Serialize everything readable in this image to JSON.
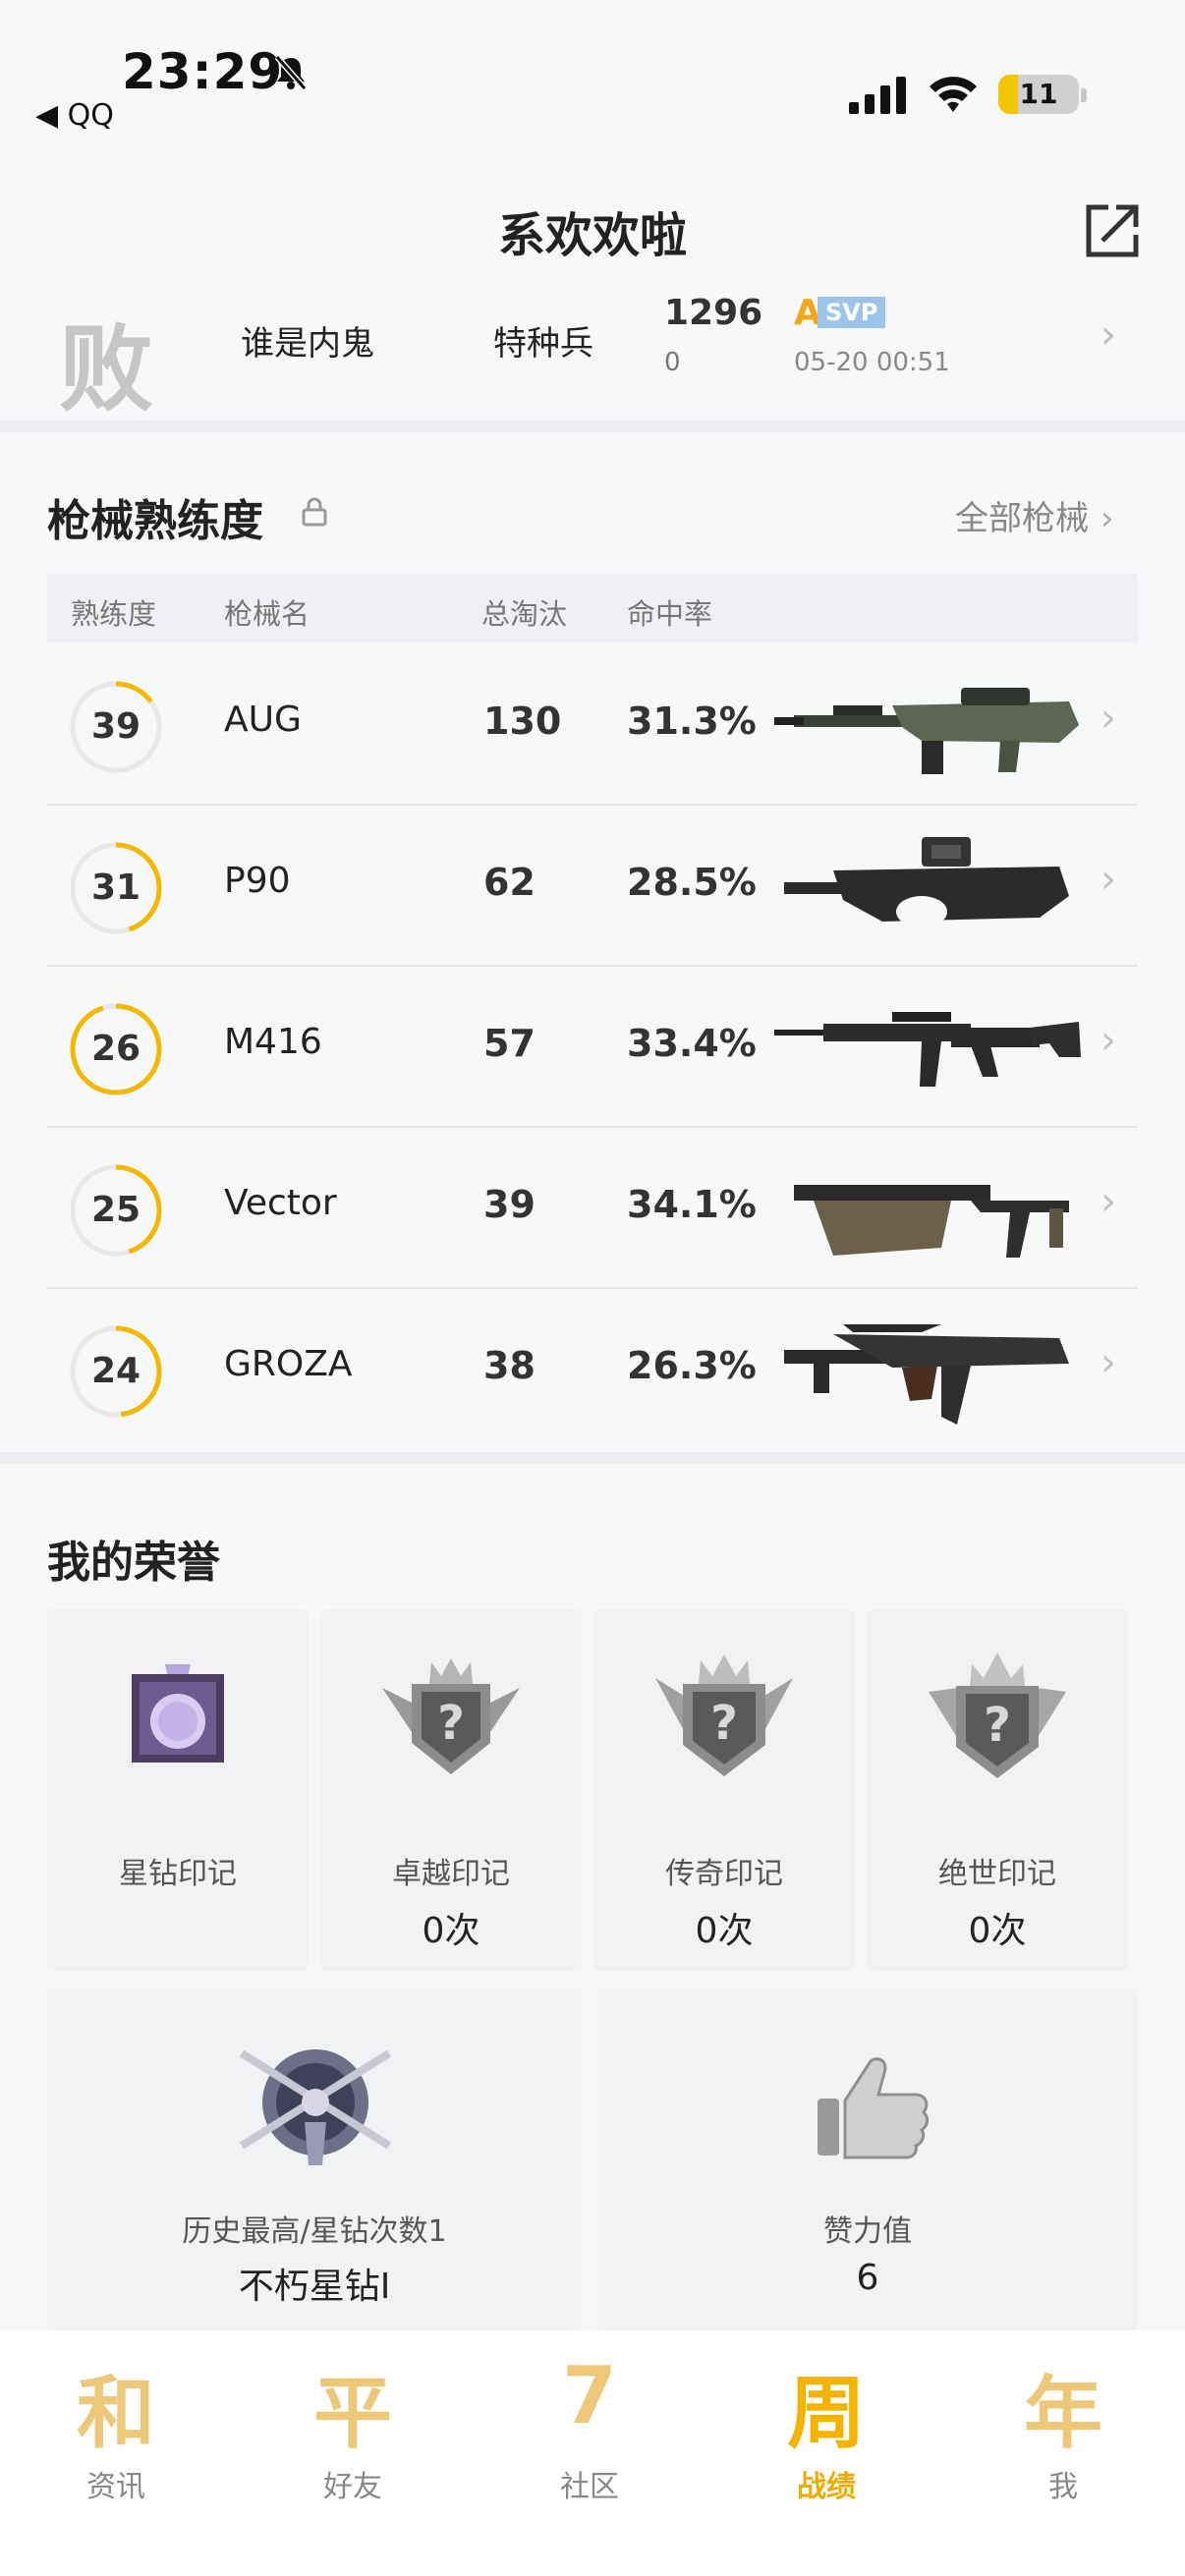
{
  "status_bar": {
    "time": "23:29",
    "back_app": "QQ",
    "battery": "11",
    "battery_level": 0.11
  },
  "header": {
    "title": "系欢欢啦"
  },
  "last_match": {
    "result": "败",
    "mode": "谁是内鬼",
    "role": "特种兵",
    "score": "1296",
    "score_change": "0",
    "grade": "A",
    "grade_tag": "SVP",
    "time": "05-20 00:51"
  },
  "weapons": {
    "title": "枪械熟练度",
    "all_link": "全部枪械",
    "columns": [
      "熟练度",
      "枪械名",
      "总淘汰",
      "命中率"
    ],
    "rows": [
      {
        "level": "39",
        "progress": 0.15,
        "name": "AUG",
        "kills": "130",
        "accuracy": "31.3%"
      },
      {
        "level": "31",
        "progress": 0.45,
        "name": "P90",
        "kills": "62",
        "accuracy": "28.5%"
      },
      {
        "level": "26",
        "progress": 0.95,
        "name": "M416",
        "kills": "57",
        "accuracy": "33.4%"
      },
      {
        "level": "25",
        "progress": 0.45,
        "name": "Vector",
        "kills": "39",
        "accuracy": "34.1%"
      },
      {
        "level": "24",
        "progress": 0.48,
        "name": "GROZA",
        "kills": "38",
        "accuracy": "26.3%"
      }
    ]
  },
  "honors": {
    "title": "我的荣誉",
    "marks": [
      {
        "label": "星钻印记",
        "count": ""
      },
      {
        "label": "卓越印记",
        "count": "0次"
      },
      {
        "label": "传奇印记",
        "count": "0次"
      },
      {
        "label": "绝世印记",
        "count": "0次"
      }
    ],
    "highest": {
      "label": "历史最高/星钻次数1",
      "value": "不朽星钻Ⅰ"
    },
    "likes": {
      "label": "赞力值",
      "value": "6"
    }
  },
  "bottom_nav": {
    "items": [
      {
        "glyph": "和",
        "label": "资讯"
      },
      {
        "glyph": "平",
        "label": "好友"
      },
      {
        "glyph": "7",
        "label": "社区"
      },
      {
        "glyph": "周",
        "label": "战绩"
      },
      {
        "glyph": "年",
        "label": "我"
      }
    ],
    "active_index": 3
  },
  "colors": {
    "accent": "#f3b400",
    "ring_track": "#e8e8e8",
    "ring_fill": "#f5b800"
  }
}
